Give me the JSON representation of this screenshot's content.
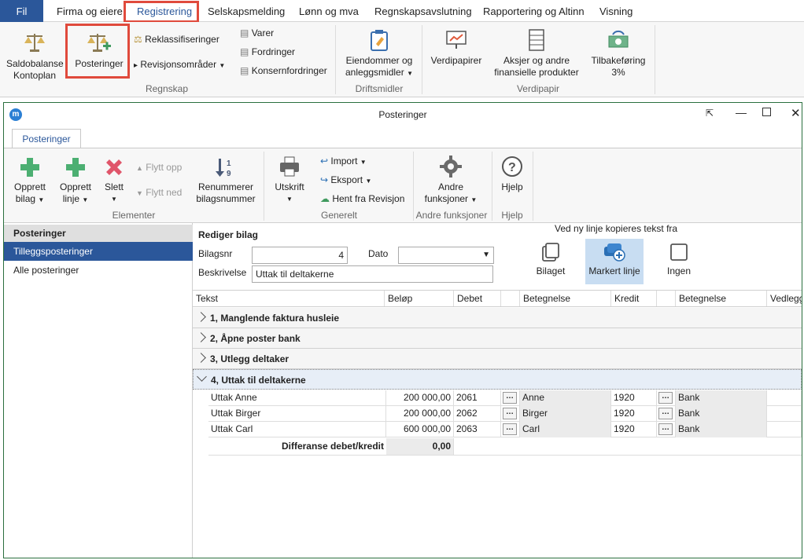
{
  "menubar": {
    "file": "Fil",
    "tabs": [
      "Firma og eiere",
      "Registrering",
      "Selskapsmelding",
      "Lønn og mva",
      "Regnskapsavslutning",
      "Rapportering og Altinn",
      "Visning"
    ]
  },
  "ribbon": {
    "saldobalanse": [
      "Saldobalanse",
      "Kontoplan"
    ],
    "posteringer": "Posteringer",
    "reklass": "Reklassifiseringer",
    "revisjon": "Revisjonsområder",
    "varer": "Varer",
    "fordringer": "Fordringer",
    "konsern": "Konsernfordringer",
    "eiendommer": [
      "Eiendommer og",
      "anleggsmidler"
    ],
    "verdipapirer": "Verdipapirer",
    "aksjer": [
      "Aksjer og andre",
      "finansielle produkter"
    ],
    "tilbake": [
      "Tilbakeføring",
      "3%"
    ],
    "groups": {
      "regnskap": "Regnskap",
      "drift": "Driftsmidler",
      "verdi": "Verdipapir"
    }
  },
  "window": {
    "title": "Posteringer",
    "tab": "Posteringer",
    "ribbon": {
      "opprett_bilag": [
        "Opprett",
        "bilag"
      ],
      "opprett_linje": [
        "Opprett",
        "linje"
      ],
      "slett": "Slett",
      "flytt_opp": "Flytt opp",
      "flytt_ned": "Flytt ned",
      "renummerer": [
        "Renummerer",
        "bilagsnummer"
      ],
      "utskrift": "Utskrift",
      "import": "Import",
      "eksport": "Eksport",
      "hent": "Hent fra Revisjon",
      "andre": [
        "Andre",
        "funksjoner"
      ],
      "hjelp": "Hjelp",
      "groups": {
        "elementer": "Elementer",
        "generelt": "Generelt",
        "andre": "Andre funksjoner",
        "hjelp": "Hjelp"
      }
    }
  },
  "nav": {
    "header": "Posteringer",
    "items": [
      "Tilleggsposteringer",
      "Alle posteringer"
    ]
  },
  "edit": {
    "title": "Rediger bilag",
    "bilagsnr_label": "Bilagsnr",
    "bilagsnr": "4",
    "dato_label": "Dato",
    "dato": "",
    "beskrivelse_label": "Beskrivelse",
    "beskrivelse": "Uttak til deltakerne",
    "copy_title": "Ved ny linje kopieres tekst fra",
    "copy_options": [
      "Bilaget",
      "Markert linje",
      "Ingen"
    ]
  },
  "grid": {
    "columns": [
      "Tekst",
      "Beløp",
      "Debet",
      "",
      "Betegnelse",
      "Kredit",
      "",
      "Betegnelse",
      "Vedlegg"
    ],
    "groups": [
      "1, Manglende faktura husleie",
      "2, Åpne poster bank",
      "3, Utlegg deltaker",
      "4, Uttak til deltakerne"
    ],
    "rows": [
      {
        "tekst": "Uttak Anne",
        "belop": "200 000,00",
        "debet": "2061",
        "dbet": "Anne",
        "kredit": "1920",
        "kbet": "Bank"
      },
      {
        "tekst": "Uttak Birger",
        "belop": "200 000,00",
        "debet": "2062",
        "dbet": "Birger",
        "kredit": "1920",
        "kbet": "Bank"
      },
      {
        "tekst": "Uttak Carl",
        "belop": "600 000,00",
        "debet": "2063",
        "dbet": "Carl",
        "kredit": "1920",
        "kbet": "Bank"
      }
    ],
    "diff_label": "Differanse debet/kredit",
    "diff_value": "0,00"
  }
}
